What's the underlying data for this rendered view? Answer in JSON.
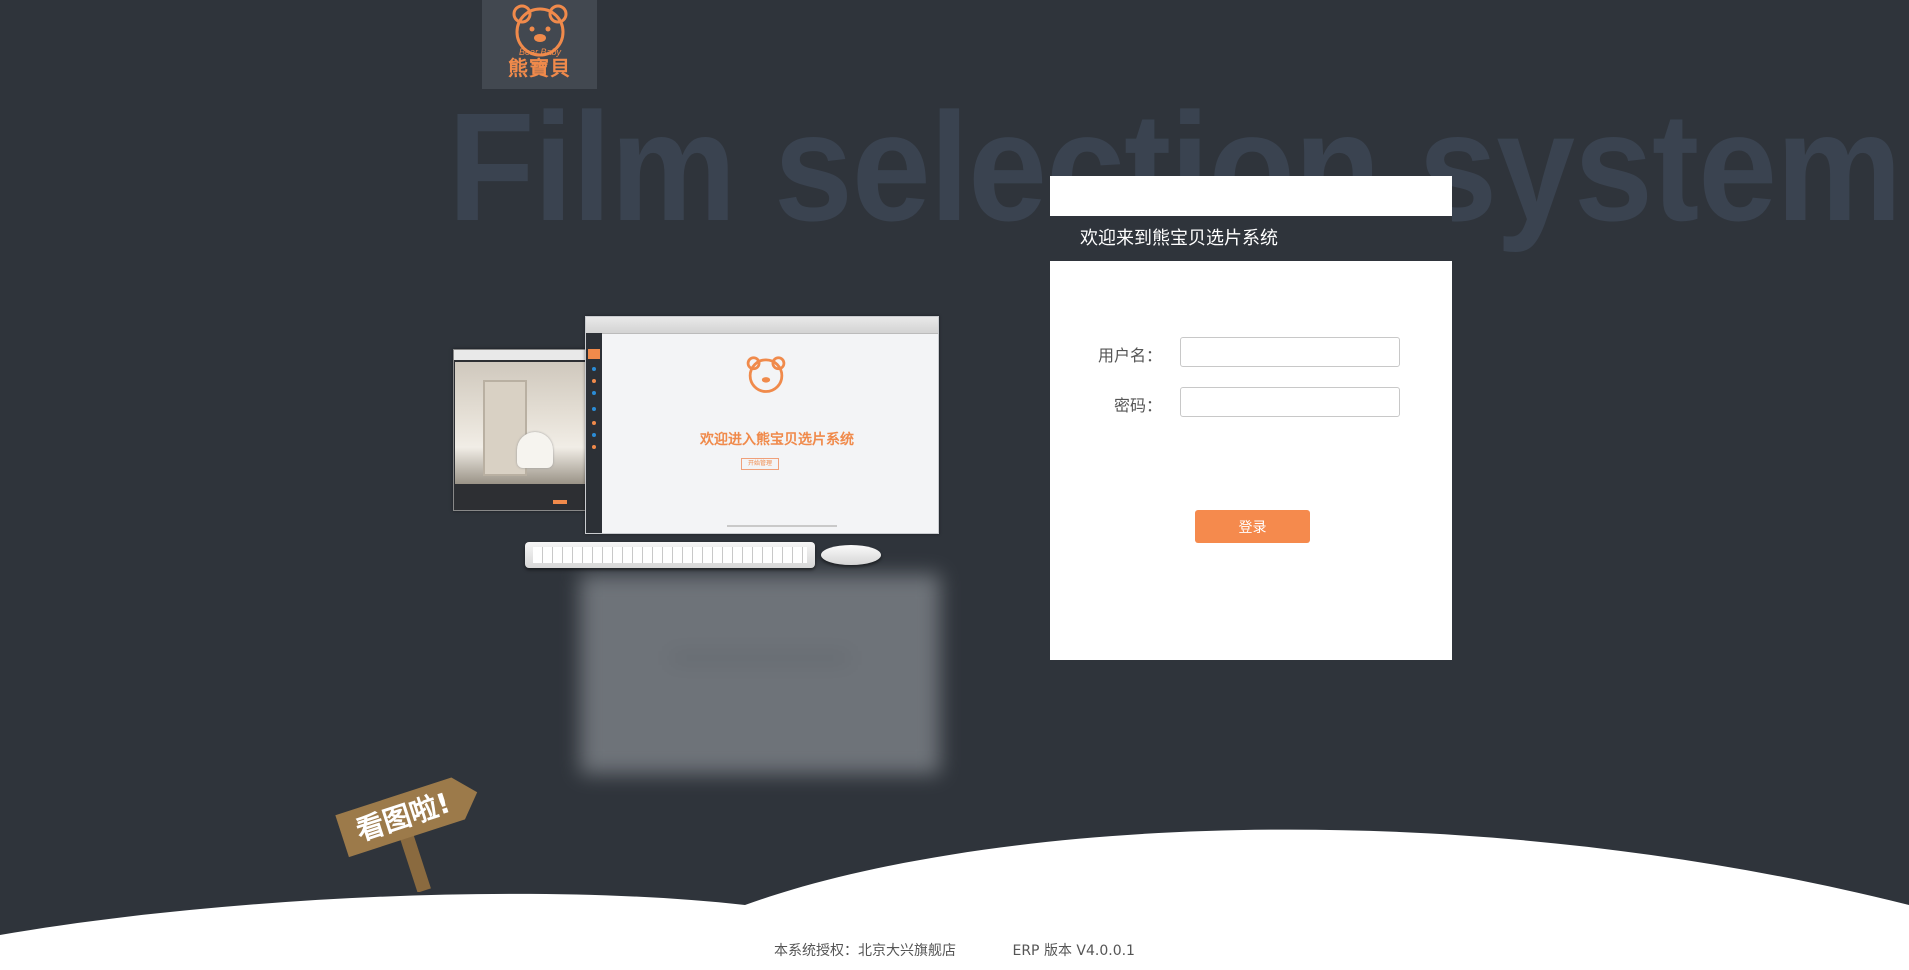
{
  "header": {
    "logo_text": "熊寶貝",
    "logo_sub": "Bear Baby",
    "background_title": "Film selection system"
  },
  "illustration": {
    "monitor_welcome": "欢迎进入熊宝贝选片系统",
    "monitor_button": "开始管理"
  },
  "login": {
    "title": "欢迎来到熊宝贝选片系统",
    "username_label": "用户名：",
    "password_label": "密码：",
    "username_value": "",
    "password_value": "",
    "submit_label": "登录"
  },
  "sign": {
    "text": "看图啦!"
  },
  "footer": {
    "license": "本系统授权：北京大兴旗舰店",
    "version": "ERP 版本 V4.0.0.1"
  },
  "colors": {
    "background": "#2f343b",
    "accent": "#f58a4d",
    "panel": "#ffffff"
  }
}
